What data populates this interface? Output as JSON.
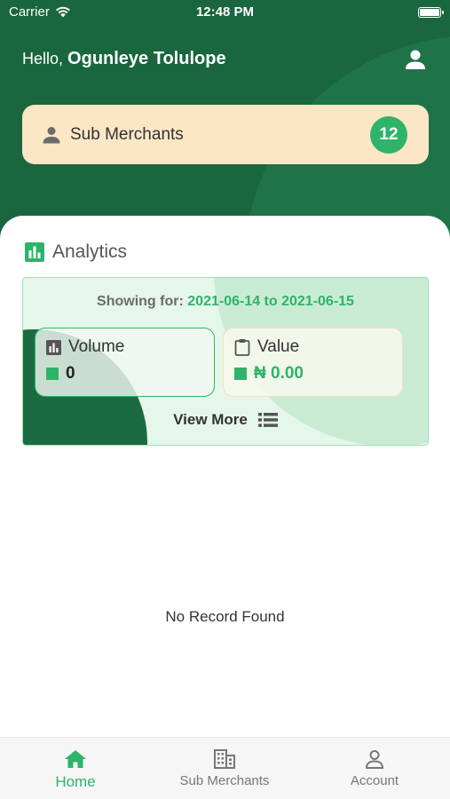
{
  "status_bar": {
    "carrier": "Carrier",
    "time": "12:48 PM"
  },
  "header": {
    "greeting_prefix": "Hello,",
    "user_name": "Ogunleye Tolulope",
    "sub_merchants_label": "Sub Merchants",
    "sub_merchants_count": "12"
  },
  "analytics": {
    "title": "Analytics",
    "showing_label": "Showing for:",
    "date_range": "2021-06-14 to 2021-06-15",
    "volume_label": "Volume",
    "volume_value": "0",
    "value_label": "Value",
    "value_amount": "₦ 0.00",
    "view_more": "View More"
  },
  "empty_state": "No Record Found",
  "tabbar": {
    "home": "Home",
    "sub_merchants": "Sub Merchants",
    "account": "Account",
    "active": "home"
  },
  "colors": {
    "header_green": "#19663f",
    "accent_green": "#2fb36a",
    "card_cream": "#fbe6c6"
  },
  "icons": [
    "wifi-icon",
    "battery-icon",
    "user-icon",
    "person-icon",
    "bar-chart-icon",
    "clipboard-icon",
    "list-icon",
    "home-icon",
    "building-icon",
    "account-icon"
  ]
}
